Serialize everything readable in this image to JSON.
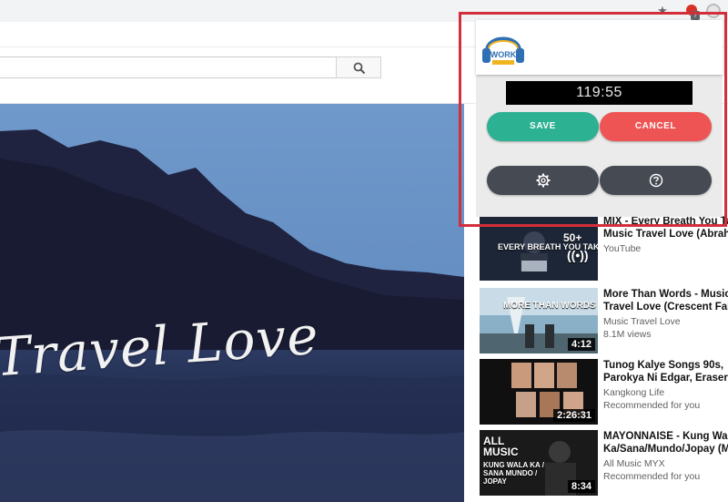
{
  "search": {
    "value": "",
    "placeholder": ""
  },
  "video": {
    "caption": "Travel Love"
  },
  "popup": {
    "logo_text": "WORK",
    "timer": "119:55",
    "save_label": "SAVE",
    "cancel_label": "CANCEL"
  },
  "recommendations": [
    {
      "title": "MIX - Every Breath You Take",
      "channel": "Music Travel Love (Abraham",
      "meta": "YouTube",
      "thumb_text": "EVERY BREATH YOU TAKE",
      "thumb_badge": "50+",
      "duration": ""
    },
    {
      "title": "More Than Words - Music",
      "channel": "Travel Love (Crescent Falls,",
      "meta": "Music Travel Love",
      "views": "8.1M views",
      "thumb_text": "MORE THAN WORDS",
      "duration": "4:12"
    },
    {
      "title": "Tunog Kalye Songs 90s,",
      "channel": "Parokya Ni Edgar, Eraserhead",
      "meta": "Kangkong Life",
      "views": "Recommended for you",
      "duration": "2:26:31"
    },
    {
      "title": "MAYONNAISE - Kung Wala",
      "channel": "Ka/Sana/Mundo/Jopay (MYX",
      "meta": "All Music MYX",
      "views": "Recommended for you",
      "thumb_text": "KUNG WALA KA / SANA MUNDO / JOPAY",
      "thumb_brand": "ALL MUSIC",
      "duration": "8:34"
    }
  ],
  "colors": {
    "save": "#2cb192",
    "cancel": "#ee5454",
    "dark_button": "#464a52",
    "frame": "#d32f3b"
  },
  "icons": [
    "star-icon",
    "extension-badge-icon",
    "profile-icon",
    "search-icon",
    "gear-icon",
    "help-circle-icon",
    "headphones-logo-icon"
  ]
}
